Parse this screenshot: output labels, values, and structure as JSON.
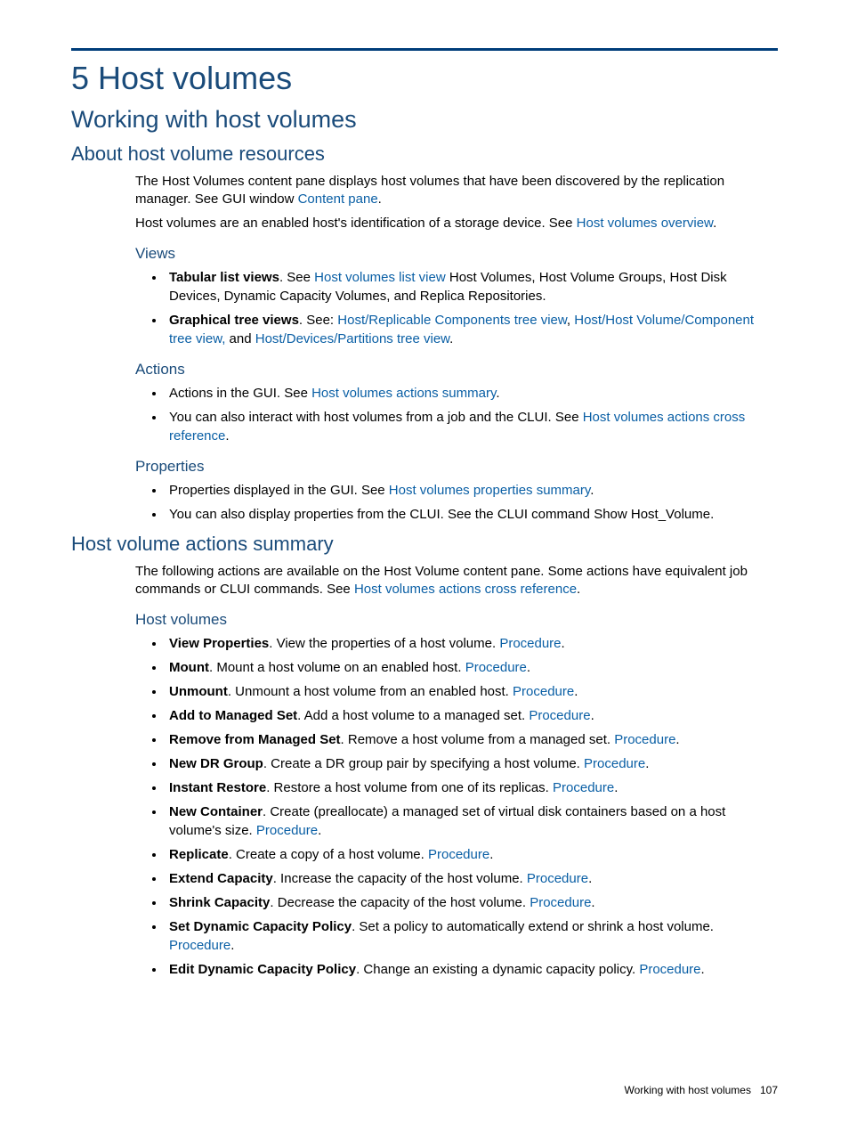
{
  "chapter": "5 Host volumes",
  "section": "Working with host volumes",
  "sub1": {
    "title": "About host volume resources",
    "p1a": "The Host Volumes content pane displays host volumes that have been discovered by the replication manager. See GUI window ",
    "p1link": "Content pane",
    "p1b": ".",
    "p2a": "Host volumes are an enabled host's identification of a storage device. See ",
    "p2link": "Host volumes overview",
    "p2b": ".",
    "views": {
      "title": "Views",
      "i1bold": "Tabular list views",
      "i1a": ". See ",
      "i1link": "Host volumes list view",
      "i1b": " Host Volumes, Host Volume Groups, Host Disk Devices, Dynamic Capacity Volumes, and Replica Repositories.",
      "i2bold": "Graphical tree views",
      "i2a": ". See: ",
      "i2link1": "Host/Replicable Components tree view",
      "i2b": ", ",
      "i2link2": "Host/Host Volume/Component tree view,",
      "i2c": " and ",
      "i2link3": "Host/Devices/Partitions tree view",
      "i2d": "."
    },
    "actions": {
      "title": "Actions",
      "i1a": "Actions in the GUI. See ",
      "i1link": "Host volumes actions summary",
      "i1b": ".",
      "i2a": "You can also interact with host volumes from a job and the CLUI. See ",
      "i2link": "Host volumes actions cross reference",
      "i2b": "."
    },
    "props": {
      "title": "Properties",
      "i1a": "Properties displayed in the GUI. See ",
      "i1link": "Host volumes properties summary",
      "i1b": ".",
      "i2": "You can also display properties from the CLUI. See the CLUI command Show Host_Volume."
    }
  },
  "sub2": {
    "title": "Host volume actions summary",
    "p1a": "The following actions are available on the Host Volume content pane. Some actions have equivalent job commands or CLUI commands. See ",
    "p1link": "Host volumes actions cross reference",
    "p1b": ".",
    "hv": {
      "title": "Host volumes",
      "items": [
        {
          "bold": "View Properties",
          "text": ". View the properties of a host volume. ",
          "link": "Procedure",
          "tail": "."
        },
        {
          "bold": "Mount",
          "text": ". Mount a host volume on an enabled host. ",
          "link": "Procedure",
          "tail": "."
        },
        {
          "bold": "Unmount",
          "text": ". Unmount a host volume from an enabled host. ",
          "link": "Procedure",
          "tail": "."
        },
        {
          "bold": "Add to Managed Set",
          "text": ". Add a host volume to a managed set. ",
          "link": "Procedure",
          "tail": "."
        },
        {
          "bold": "Remove from Managed Set",
          "text": ". Remove a host volume from a managed set. ",
          "link": "Procedure",
          "tail": "."
        },
        {
          "bold": "New DR Group",
          "text": ". Create a DR group pair by specifying a host volume. ",
          "link": "Procedure",
          "tail": "."
        },
        {
          "bold": "Instant Restore",
          "text": ". Restore a host volume from one of its replicas. ",
          "link": "Procedure",
          "tail": "."
        },
        {
          "bold": "New Container",
          "text": ". Create (preallocate) a managed set of virtual disk containers based on a host volume's size. ",
          "link": "Procedure",
          "tail": "."
        },
        {
          "bold": "Replicate",
          "text": ". Create a copy of a host volume. ",
          "link": "Procedure",
          "tail": "."
        },
        {
          "bold": "Extend Capacity",
          "text": ". Increase the capacity of the host volume. ",
          "link": "Procedure",
          "tail": "."
        },
        {
          "bold": "Shrink Capacity",
          "text": ". Decrease the capacity of the host volume. ",
          "link": "Procedure",
          "tail": "."
        },
        {
          "bold": "Set Dynamic Capacity Policy",
          "text": ". Set a policy to automatically extend or shrink a host volume. ",
          "link": "Procedure",
          "tail": "."
        },
        {
          "bold": "Edit Dynamic Capacity Policy",
          "text": ". Change an existing a dynamic capacity policy. ",
          "link": "Procedure",
          "tail": "."
        }
      ]
    }
  },
  "footer": {
    "text": "Working with host volumes",
    "page": "107"
  }
}
